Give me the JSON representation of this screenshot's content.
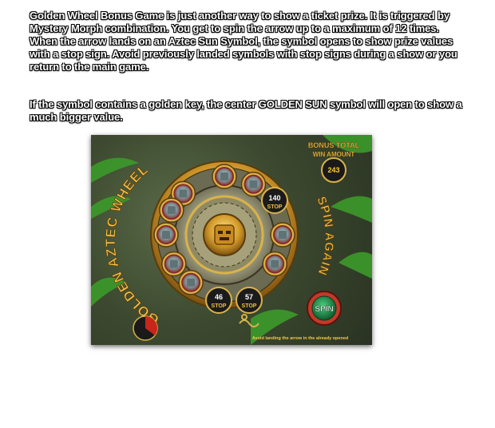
{
  "instructions": {
    "paragraph_1": "Golden Wheel Bonus Game is just another way to show a ticket prize. It is triggered by Mystery Morph combination. You get to spin the arrow up to a maximum of 12 times. When the arrow lands on an Aztec Sun Symbol, the symbol opens to show prize values with a stop sign. Avoid previously landed symbols with stop signs during a show or you return to the main game.",
    "paragraph_2": "If the symbol contains a golden key, the center GOLDEN SUN symbol will open to show a much bigger value."
  },
  "game": {
    "title_left": "GOLDEN AZTEC WHEEL",
    "title_right": "SPIN AGAIN",
    "bonus_total_label": "BONUS TOTAL",
    "win_amount_label": "WIN AMOUNT",
    "bonus_total_value": "243",
    "spin_button_label": "SPIN",
    "footer_text": "Avoid landing the arrow in the already opened",
    "opened_symbols": [
      {
        "value": "140",
        "stop": "STOP"
      },
      {
        "value": "46",
        "stop": "STOP"
      },
      {
        "value": "57",
        "stop": "STOP"
      }
    ],
    "colors": {
      "gold": "#d9b24a",
      "stone": "#8c8f78",
      "spin_green": "#1f8a4a",
      "spin_ring": "#c23a2a",
      "leaf": "#3c9a2a"
    }
  }
}
